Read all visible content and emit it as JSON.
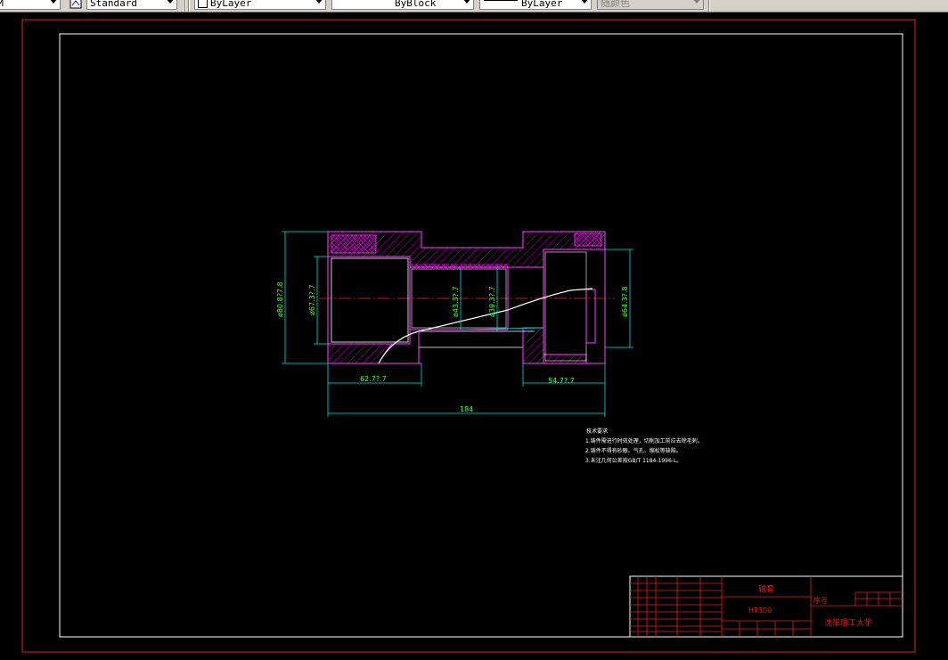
{
  "toolbar": {
    "style_combo": "Standard",
    "layer_combo": "ByLayer",
    "linetype_combo": "ByBlock",
    "lineweight_combo": "ByLayer",
    "color_combo": "随颜色"
  },
  "drawing": {
    "dim_outer_dia": "ø80.8?7.8",
    "dim_bore_left": "ø67.3?.7",
    "dim_mid_bore": "ø43.3?.7",
    "dim_neck": "ø39.3?.7",
    "dim_right_dia": "ø64.3?.8",
    "dim_left_len": "62.7?.7",
    "dim_right_len": "54.7?.7",
    "dim_total": "184",
    "tech_title": "技术要求",
    "tech_line1": "1.铸件需进行时效处理，切削加工前应去除毛刺。",
    "tech_line2": "2.铸件不得有砂眼、气孔、缩松等缺陷。",
    "tech_line3": "3.未注几何公差按GB/T 1184-1996-L。",
    "title_part_name": "轴套",
    "title_material": "HT300",
    "title_scale_label": "序号",
    "title_company": "沈阳理工大学"
  }
}
